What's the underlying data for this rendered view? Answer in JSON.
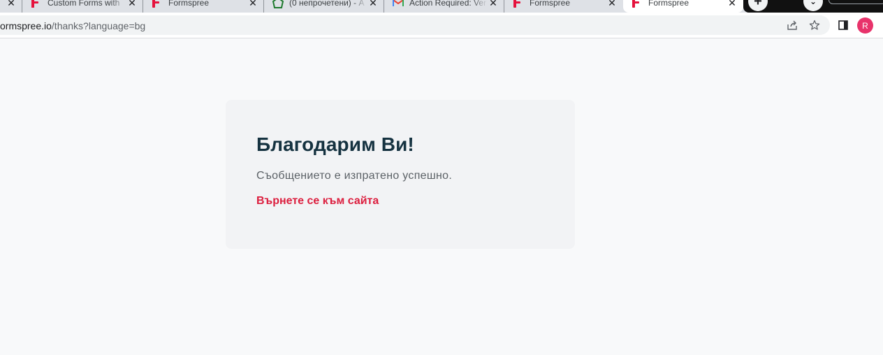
{
  "browser": {
    "tabs": [
      {
        "title": "",
        "favicon": "unknown",
        "active": false
      },
      {
        "title": "Custom Forms with",
        "favicon": "formspree-logo",
        "active": false
      },
      {
        "title": "Formspree",
        "favicon": "formspree-logo",
        "active": false
      },
      {
        "title": "(0 непрочетени) - А",
        "favicon": "mail-icon",
        "active": false
      },
      {
        "title": "Action Required: Ver",
        "favicon": "gmail-icon",
        "active": false
      },
      {
        "title": "Formspree",
        "favicon": "formspree-logo",
        "active": false
      },
      {
        "title": "Formspree",
        "favicon": "formspree-logo",
        "active": true
      }
    ],
    "new_tab_label": "+",
    "url": {
      "host": "ormspree.io",
      "path": "/thanks?language=bg"
    },
    "profile_initial": "R",
    "colors": {
      "brand": "#e5123d",
      "avatar": "#e8336b"
    }
  },
  "page": {
    "heading": "Благодарим Ви!",
    "message": "Съобщението е изпратено успешно.",
    "back_link": "Върнете се към сайта",
    "colors": {
      "heading": "#153240",
      "link": "#dc1e3e",
      "card": "#f2f3f5"
    }
  }
}
